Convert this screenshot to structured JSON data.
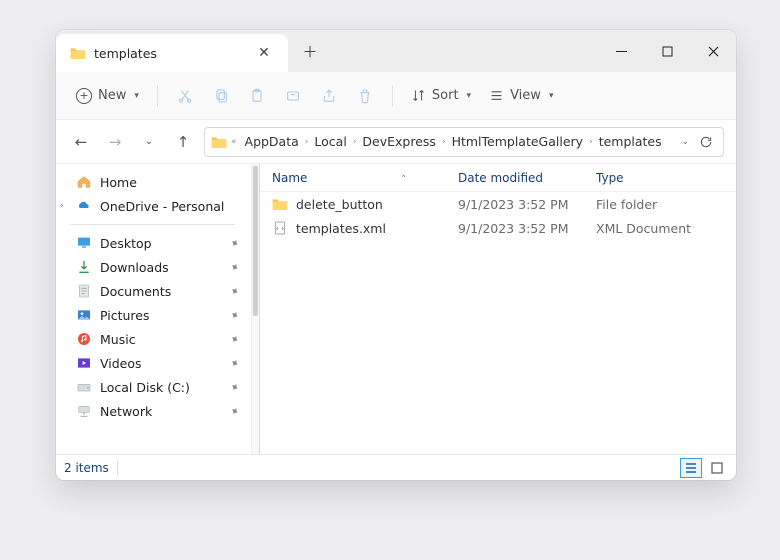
{
  "window": {
    "tab_title": "templates"
  },
  "toolbar": {
    "new_label": "New",
    "sort_label": "Sort",
    "view_label": "View"
  },
  "breadcrumbs": {
    "segments": [
      "AppData",
      "Local",
      "DevExpress",
      "HtmlTemplateGallery",
      "templates"
    ]
  },
  "sidebar": {
    "top": [
      {
        "label": "Home",
        "icon": "home"
      },
      {
        "label": "OneDrive - Personal",
        "icon": "onedrive",
        "expandable": true
      }
    ],
    "places": [
      {
        "label": "Desktop",
        "icon": "desktop"
      },
      {
        "label": "Downloads",
        "icon": "downloads"
      },
      {
        "label": "Documents",
        "icon": "documents"
      },
      {
        "label": "Pictures",
        "icon": "pictures"
      },
      {
        "label": "Music",
        "icon": "music"
      },
      {
        "label": "Videos",
        "icon": "videos"
      },
      {
        "label": "Local Disk (C:)",
        "icon": "disk"
      },
      {
        "label": "Network",
        "icon": "network"
      }
    ]
  },
  "columns": {
    "name": "Name",
    "date": "Date modified",
    "type": "Type"
  },
  "items": [
    {
      "name": "delete_button",
      "date": "9/1/2023 3:52 PM",
      "type": "File folder",
      "icon": "folder"
    },
    {
      "name": "templates.xml",
      "date": "9/1/2023 3:52 PM",
      "type": "XML Document",
      "icon": "xml"
    }
  ],
  "status": {
    "text": "2 items"
  }
}
